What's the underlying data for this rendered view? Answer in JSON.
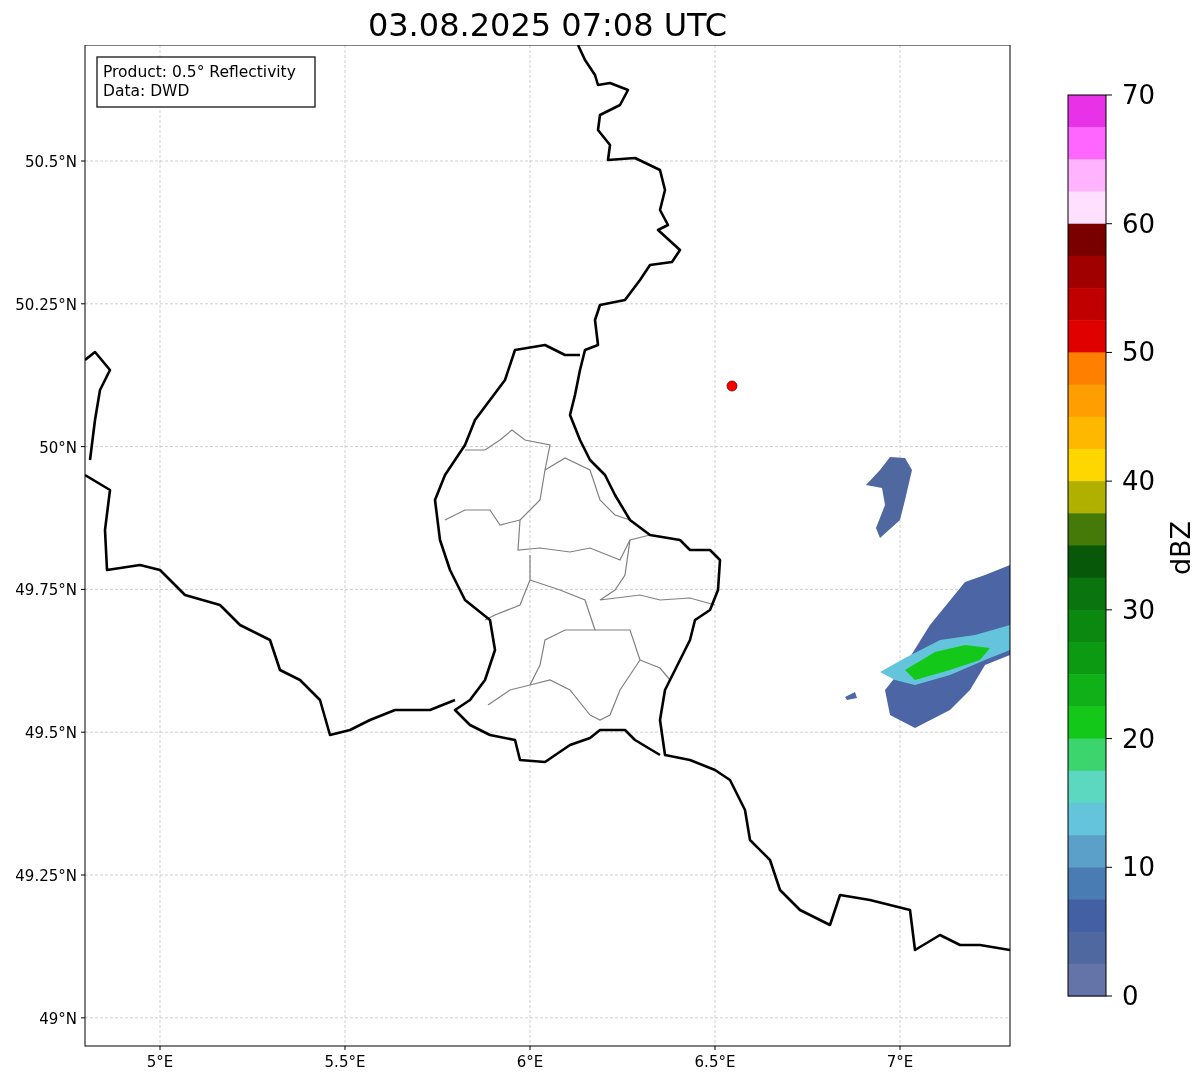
{
  "title": "03.08.2025 07:08 UTC",
  "map": {
    "info_box": [
      "Product: 0.5° Reflectivity",
      "Data: DWD"
    ],
    "y_ticks": [
      "50.5°N",
      "50.25°N",
      "50°N",
      "49.75°N",
      "49.5°N",
      "49.25°N",
      "49°N"
    ],
    "x_ticks": [
      "5°E",
      "5.5°E",
      "6°E",
      "6.5°E",
      "7°E"
    ]
  },
  "colorbar": {
    "label": "dBZ",
    "ticks": [
      "70",
      "60",
      "50",
      "40",
      "30",
      "20",
      "10",
      "0"
    ],
    "levels": [
      {
        "color": "#e832e8"
      },
      {
        "color": "#ff66ff"
      },
      {
        "color": "#ffb3ff"
      },
      {
        "color": "#ffe0ff"
      },
      {
        "color": "#7a0000"
      },
      {
        "color": "#a00000"
      },
      {
        "color": "#c00000"
      },
      {
        "color": "#e00000"
      },
      {
        "color": "#ff8000"
      },
      {
        "color": "#ff9e00"
      },
      {
        "color": "#ffb800"
      },
      {
        "color": "#ffd700"
      },
      {
        "color": "#b0b000"
      },
      {
        "color": "#457a08"
      },
      {
        "color": "#08580a"
      },
      {
        "color": "#0a740e"
      },
      {
        "color": "#0a880f"
      },
      {
        "color": "#0c9a12"
      },
      {
        "color": "#10b018"
      },
      {
        "color": "#14c81a"
      },
      {
        "color": "#3cd46c"
      },
      {
        "color": "#5cd8c0"
      },
      {
        "color": "#64c4dc"
      },
      {
        "color": "#5aa0c8"
      },
      {
        "color": "#4a7cb4"
      },
      {
        "color": "#4460a4"
      },
      {
        "color": "#5068a0"
      },
      {
        "color": "#6474a8"
      }
    ]
  }
}
